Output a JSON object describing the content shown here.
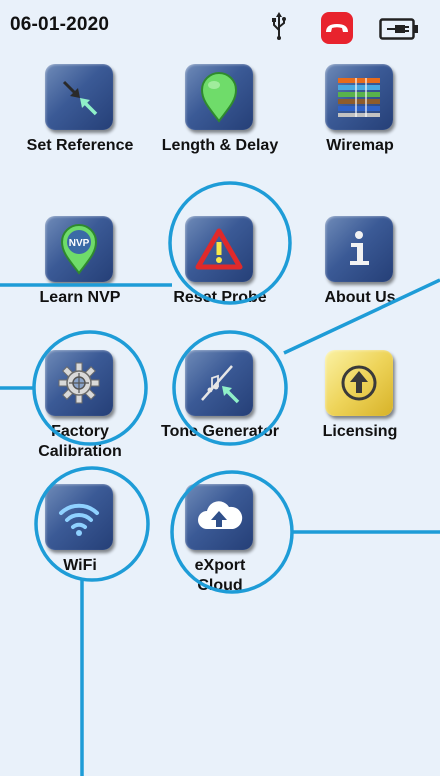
{
  "status_bar": {
    "date": "06-01-2020",
    "icons": [
      "usb-icon",
      "hang-up-phone-icon",
      "battery-plug-icon"
    ]
  },
  "menu": {
    "items": [
      {
        "label": "Set Reference",
        "icon": "set-reference-arrows-icon"
      },
      {
        "label": "Length & Delay",
        "icon": "length-pin-icon"
      },
      {
        "label": "Wiremap",
        "icon": "wiremap-colored-wires-icon"
      },
      {
        "label": "Learn NVP",
        "icon": "nvp-badge-icon"
      },
      {
        "label": "Reset Probe",
        "icon": "warning-triangle-icon"
      },
      {
        "label": "About Us",
        "icon": "info-icon"
      },
      {
        "label": "Factory Calibration",
        "label_line1": "Factory",
        "label_line2": "Calibration",
        "icon": "calibration-gear-icon"
      },
      {
        "label": "Tone Generator",
        "icon": "tone-generator-icon"
      },
      {
        "label": "Licensing",
        "icon": "licensing-upload-icon",
        "accent": "#f1d24a"
      },
      {
        "label": "WiFi",
        "icon": "wifi-icon"
      },
      {
        "label": "eXport Cloud",
        "label_line1": "eXport",
        "label_line2": "Cloud",
        "icon": "cloud-upload-icon"
      }
    ]
  },
  "colors": {
    "screen_background": "#e9f1fa",
    "icon_tile": "#3b5a96",
    "annotation": "#1e9cd7",
    "phone_button": "#e8232d"
  }
}
